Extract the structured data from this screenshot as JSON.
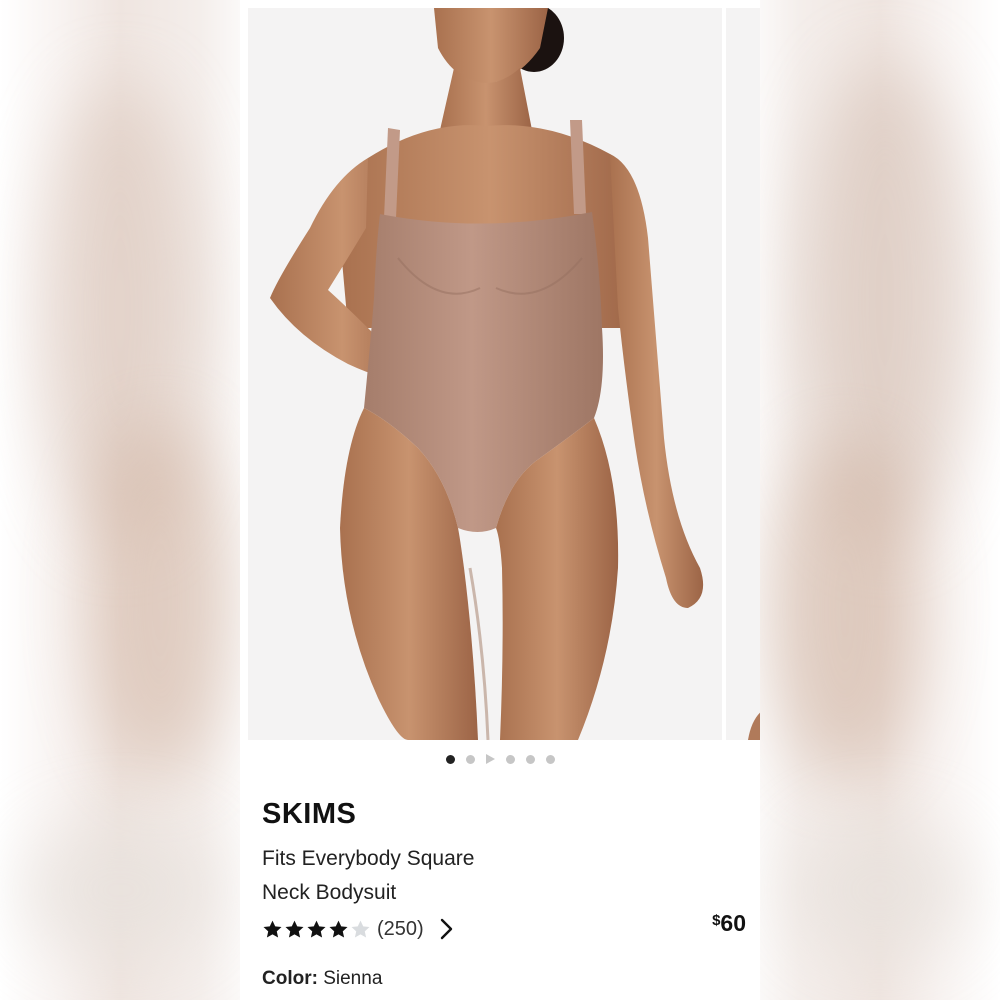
{
  "product": {
    "brand": "SKIMS",
    "name_line1": "Fits Everybody Square",
    "name_line2": "Neck Bodysuit",
    "rating": 4,
    "rating_max": 5,
    "review_count": "(250)",
    "currency": "$",
    "price": "60",
    "color_label": "Color:",
    "color_value": "Sienna"
  },
  "gallery": {
    "image_alt": "Model wearing a Sienna square neck bodysuit",
    "slide_count": 6,
    "active_index": 0,
    "video_index": 2
  },
  "colors": {
    "star_filled": "#111111",
    "star_empty": "#d9dcdf",
    "bodysuit": "#b88f7d",
    "skin": "#c08a6c",
    "image_bg": "#f4f3f3"
  },
  "icons": {
    "rating_chevron": "chevron-right-icon",
    "video_slide": "play-icon"
  }
}
